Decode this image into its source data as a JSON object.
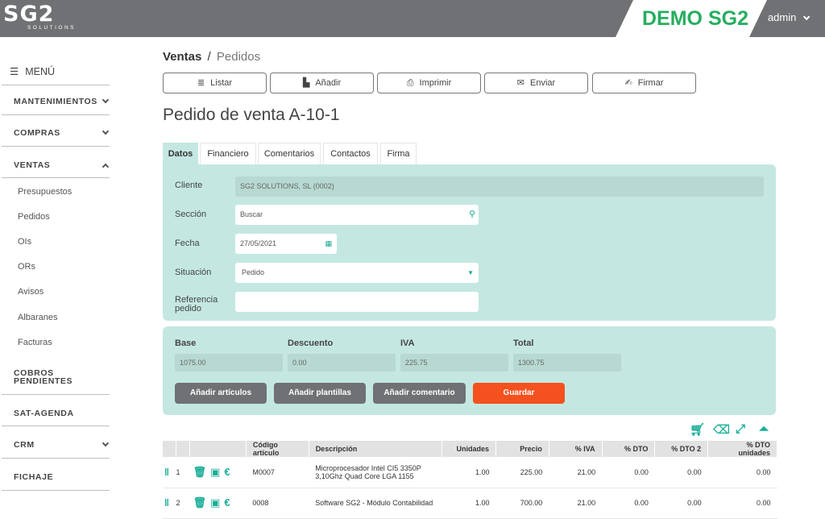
{
  "header": {
    "logo_text": "SG2",
    "logo_sub": "SOLUTIONS",
    "demo_label": "DEMO SG2",
    "user": "admin"
  },
  "sidebar": {
    "menu_label": "MENÚ",
    "sections": [
      "MANTENIMIENTOS",
      "COMPRAS",
      "VENTAS",
      "COBROS PENDIENTES",
      "SAT-AGENDA",
      "CRM",
      "FICHAJE"
    ],
    "ventas_items": [
      "Presupuestos",
      "Pedidos",
      "OIs",
      "ORs",
      "Avisos",
      "Albaranes",
      "Facturas"
    ]
  },
  "breadcrumb": {
    "section": "Ventas",
    "separator": "/",
    "current": "Pedidos"
  },
  "toolbar": {
    "listar": "Listar",
    "anadir": "Añadir",
    "imprimir": "Imprimir",
    "enviar": "Enviar",
    "firmar": "Firmar"
  },
  "page_title": "Pedido de venta A-10-1",
  "tabs": [
    "Datos",
    "Financiero",
    "Comentarios",
    "Contactos",
    "Firma"
  ],
  "form": {
    "cliente_label": "Cliente",
    "cliente_value": "SG2 SOLUTIONS, SL (0002)",
    "seccion_label": "Sección",
    "seccion_placeholder": "Buscar",
    "fecha_label": "Fecha",
    "fecha_value": "27/05/2021",
    "situacion_label": "Situación",
    "situacion_value": "Pedido",
    "referencia_label_1": "Referencia",
    "referencia_label_2": "pedido",
    "referencia_value": ""
  },
  "totals": {
    "base_label": "Base",
    "base_value": "1075.00",
    "descuento_label": "Descuento",
    "descuento_value": "0.00",
    "iva_label": "IVA",
    "iva_value": "225.75",
    "total_label": "Total",
    "total_value": "1300.75"
  },
  "actions": {
    "add_articles": "Añadir artículos",
    "add_templates": "Añadir plantillas",
    "add_comment": "Añadir comentario",
    "save": "Guardar"
  },
  "table": {
    "headers": [
      "Código artículo",
      "Descripción",
      "Unidades",
      "Precio",
      "% IVA",
      "% DTO",
      "% DTO 2",
      "% DTO unidades"
    ],
    "rows": [
      {
        "n": "1",
        "code": "M0007",
        "desc1": "Microprocesador Intel CI5 3350P",
        "desc2": "3,10Ghz Quad Core LGA 1155",
        "units": "1.00",
        "price": "225.00",
        "iva": "21.00",
        "dto": "0.00",
        "dto2": "0.00",
        "dtou": "0.00"
      },
      {
        "n": "2",
        "code": "0008",
        "desc1": "Software SG2 - Módulo Contabilidad",
        "desc2": "",
        "units": "1.00",
        "price": "700.00",
        "iva": "21.00",
        "dto": "0.00",
        "dto2": "0.00",
        "dtou": "0.00"
      }
    ]
  },
  "colors": {
    "accent": "#1aae97",
    "panel": "#c4e8e1",
    "demo_green": "#27ae60",
    "save_orange": "#f4511e",
    "topbar": "#6f7174"
  }
}
